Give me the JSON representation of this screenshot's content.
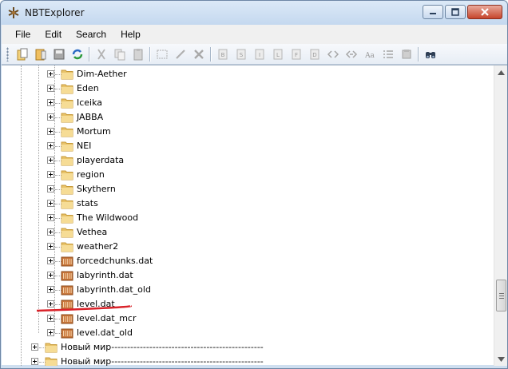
{
  "window": {
    "title": "NBTExplorer",
    "icon": "nbt-app-icon",
    "controls": [
      "minimize",
      "maximize",
      "close"
    ]
  },
  "menu": [
    {
      "id": "file",
      "label": "File"
    },
    {
      "id": "edit",
      "label": "Edit"
    },
    {
      "id": "search",
      "label": "Search"
    },
    {
      "id": "help",
      "label": "Help"
    }
  ],
  "toolbar": {
    "buttons": [
      "open-folder-icon",
      "open-file-icon",
      "save-icon",
      "refresh-icon",
      "cut-icon",
      "copy-icon",
      "paste-icon",
      "rename-icon",
      "edit-value-icon",
      "delete-icon",
      "add-byte-icon",
      "add-short-icon",
      "add-int-icon",
      "add-long-icon",
      "add-float-icon",
      "add-double-icon",
      "add-byte-array-icon",
      "add-int-array-icon",
      "add-string-icon",
      "add-list-icon",
      "add-compound-icon",
      "find-icon"
    ]
  },
  "tree": {
    "items": [
      {
        "label": "Dim-Aether",
        "type": "folder",
        "indent": 2
      },
      {
        "label": "Eden",
        "type": "folder",
        "indent": 2
      },
      {
        "label": "Iceika",
        "type": "folder",
        "indent": 2
      },
      {
        "label": "JABBA",
        "type": "folder",
        "indent": 2
      },
      {
        "label": "Mortum",
        "type": "folder",
        "indent": 2
      },
      {
        "label": "NEI",
        "type": "folder",
        "indent": 2
      },
      {
        "label": "playerdata",
        "type": "folder",
        "indent": 2
      },
      {
        "label": "region",
        "type": "folder",
        "indent": 2
      },
      {
        "label": "Skythern",
        "type": "folder",
        "indent": 2
      },
      {
        "label": "stats",
        "type": "folder",
        "indent": 2
      },
      {
        "label": "The Wildwood",
        "type": "folder",
        "indent": 2
      },
      {
        "label": "Vethea",
        "type": "folder",
        "indent": 2
      },
      {
        "label": "weather2",
        "type": "folder",
        "indent": 2
      },
      {
        "label": "forcedchunks.dat",
        "type": "file",
        "indent": 2
      },
      {
        "label": "labyrinth.dat",
        "type": "file",
        "indent": 2
      },
      {
        "label": "labyrinth.dat_old",
        "type": "file",
        "indent": 2
      },
      {
        "label": "level.dat",
        "type": "file",
        "indent": 2
      },
      {
        "label": "level.dat_mcr",
        "type": "file",
        "indent": 2
      },
      {
        "label": "level.dat_old",
        "type": "file",
        "indent": 2
      },
      {
        "label": "Новый мир------------------------------------------------",
        "type": "folder",
        "indent": 1
      },
      {
        "label": "Новый мир------------------------------------------------",
        "type": "folder",
        "indent": 1
      }
    ]
  },
  "colors": {
    "folder": "#e8c36a",
    "file": "#c9763b",
    "annotation": "#d9232a"
  }
}
